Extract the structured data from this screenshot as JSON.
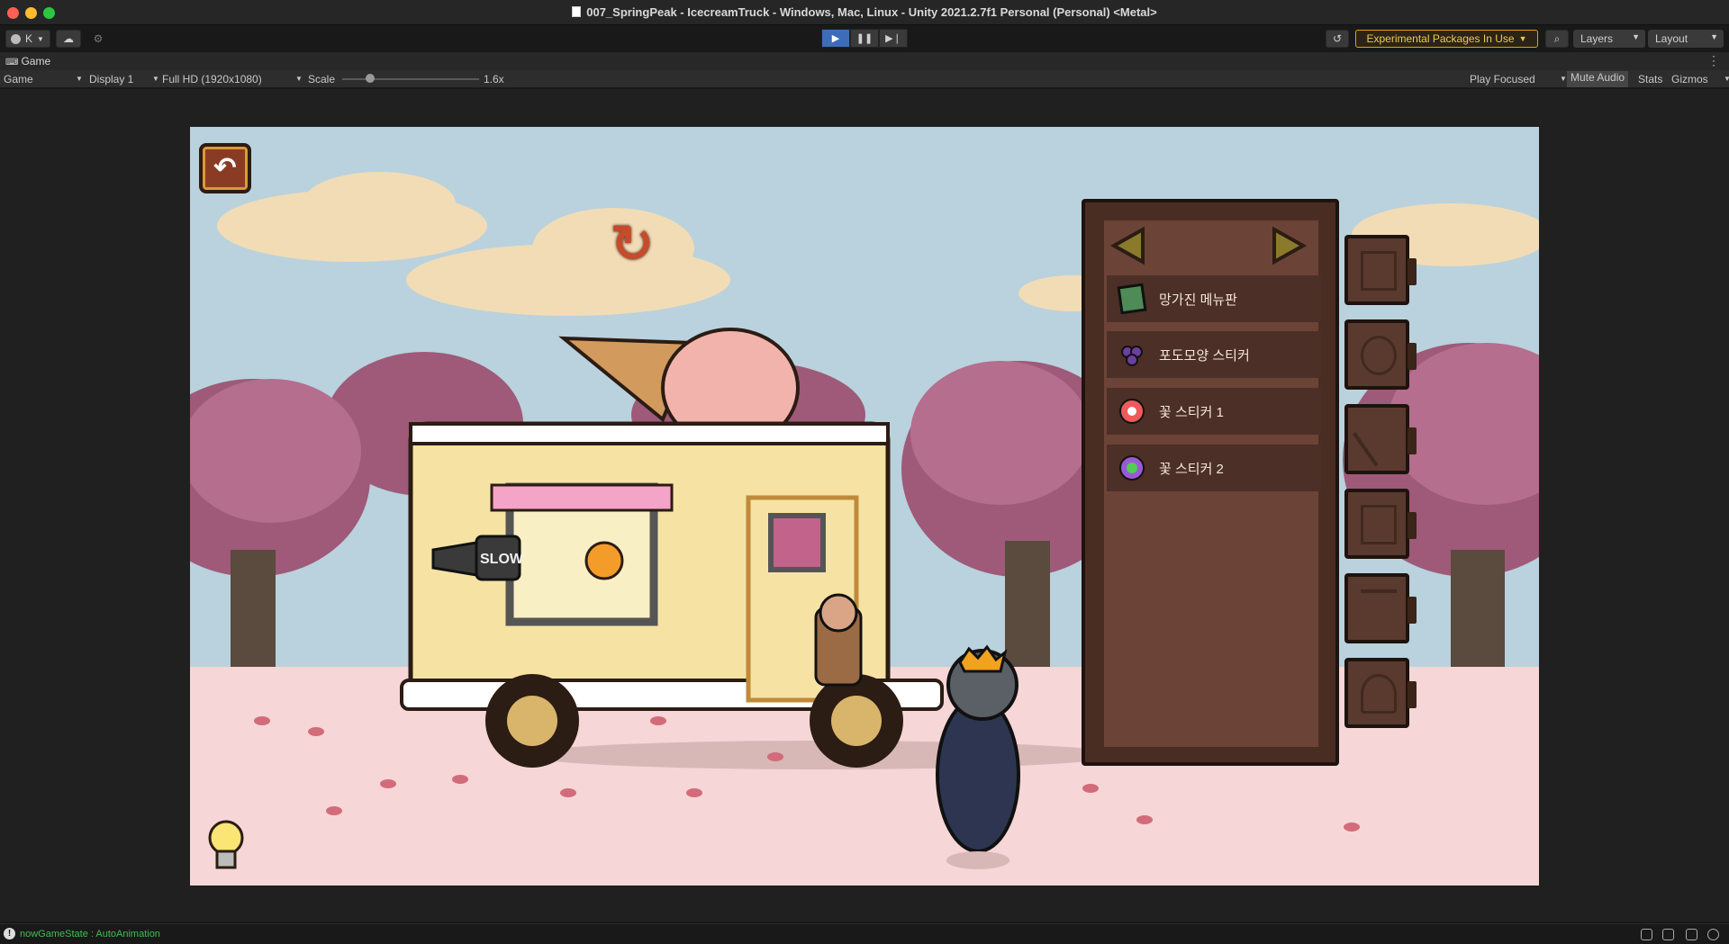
{
  "window": {
    "title": "007_SpringPeak - IcecreamTruck - Windows, Mac, Linux - Unity 2021.2.7f1 Personal (Personal) <Metal>"
  },
  "toolbar": {
    "account_label": "K",
    "experimental_label": "Experimental Packages In Use",
    "layers_label": "Layers",
    "layout_label": "Layout"
  },
  "tab": {
    "game_label": "Game"
  },
  "gamebar": {
    "view_select": "Game",
    "display_select": "Display 1",
    "resolution_select": "Full HD (1920x1080)",
    "scale_label": "Scale",
    "scale_value": "1.6x",
    "play_mode": "Play Focused",
    "mute_label": "Mute Audio",
    "stats_label": "Stats",
    "gizmos_label": "Gizmos"
  },
  "inventory": {
    "items": [
      {
        "label": "망가진 메뉴판",
        "icon": "broken-menu-board-icon"
      },
      {
        "label": "포도모양 스티커",
        "icon": "grape-sticker-icon"
      },
      {
        "label": "꽃 스티커 1",
        "icon": "flower-sticker-red-icon"
      },
      {
        "label": "꽃 스티커 2",
        "icon": "flower-sticker-purple-icon"
      }
    ]
  },
  "truck": {
    "sign_text": "SLOW"
  },
  "status": {
    "text": "nowGameState : AutoAnimation"
  },
  "colors": {
    "accent": "#3d6db8",
    "warning": "#e8a000",
    "status_text": "#3fbf4f"
  }
}
